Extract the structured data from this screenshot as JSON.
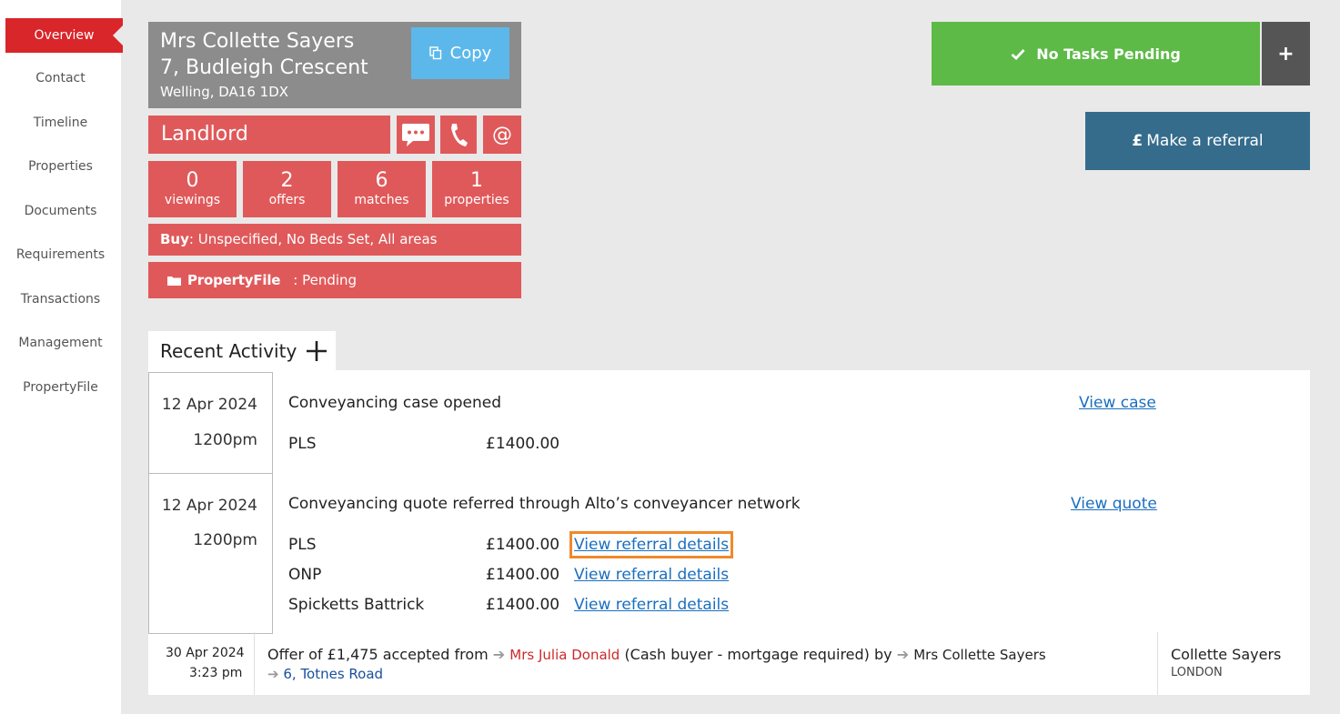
{
  "sidebar": {
    "active": "Overview",
    "items": [
      "Contact",
      "Timeline",
      "Properties",
      "Documents",
      "Requirements",
      "Transactions",
      "Management",
      "PropertyFile"
    ]
  },
  "contact": {
    "name": "Mrs Collette Sayers",
    "address_line1": "7, Budleigh Crescent",
    "address_line2": "Welling, DA16 1DX",
    "copy_label": "Copy",
    "role": "Landlord"
  },
  "stats": [
    {
      "num": "0",
      "label": "viewings"
    },
    {
      "num": "2",
      "label": "offers"
    },
    {
      "num": "6",
      "label": "matches"
    },
    {
      "num": "1",
      "label": "properties"
    }
  ],
  "buy": {
    "label": "Buy",
    "text": ": Unspecified, No Beds Set, All areas"
  },
  "propertyfile": {
    "label": "PropertyFile",
    "status": ": Pending"
  },
  "tasks": {
    "label": "No Tasks Pending",
    "plus": "+"
  },
  "referral": {
    "label": "Make a referral",
    "currency": "£"
  },
  "recent": {
    "title": "Recent Activity"
  },
  "activities": [
    {
      "date": "12 Apr 2024",
      "time": "1200pm",
      "title": "Conveyancing case opened",
      "link": "View case",
      "rows": [
        {
          "name": "PLS",
          "amount": "£1400.00"
        }
      ]
    },
    {
      "date": "12 Apr 2024",
      "time": "1200pm",
      "title": "Conveyancing quote referred through Alto’s conveyancer network",
      "link": "View quote",
      "rows": [
        {
          "name": "PLS",
          "amount": "£1400.00",
          "link": "View referral details"
        },
        {
          "name": "ONP",
          "amount": "£1400.00",
          "link": "View referral details"
        },
        {
          "name": "Spicketts Battrick",
          "amount": "£1400.00",
          "link": "View referral details"
        }
      ]
    }
  ],
  "offer": {
    "date": "30 Apr 2024",
    "time": "3:23 pm",
    "text1": "Offer of £1,475 accepted from",
    "buyer": "Mrs Julia Donald",
    "text2": "(Cash buyer - mortgage required) by",
    "seller": "Mrs Collette Sayers",
    "property": "6, Totnes Road",
    "negotiator": "Collette Sayers",
    "office": "LONDON"
  },
  "colors": {
    "red": "#e0595a",
    "green": "#5dba47",
    "blue": "#356c8c",
    "accent": "#d9262a"
  }
}
